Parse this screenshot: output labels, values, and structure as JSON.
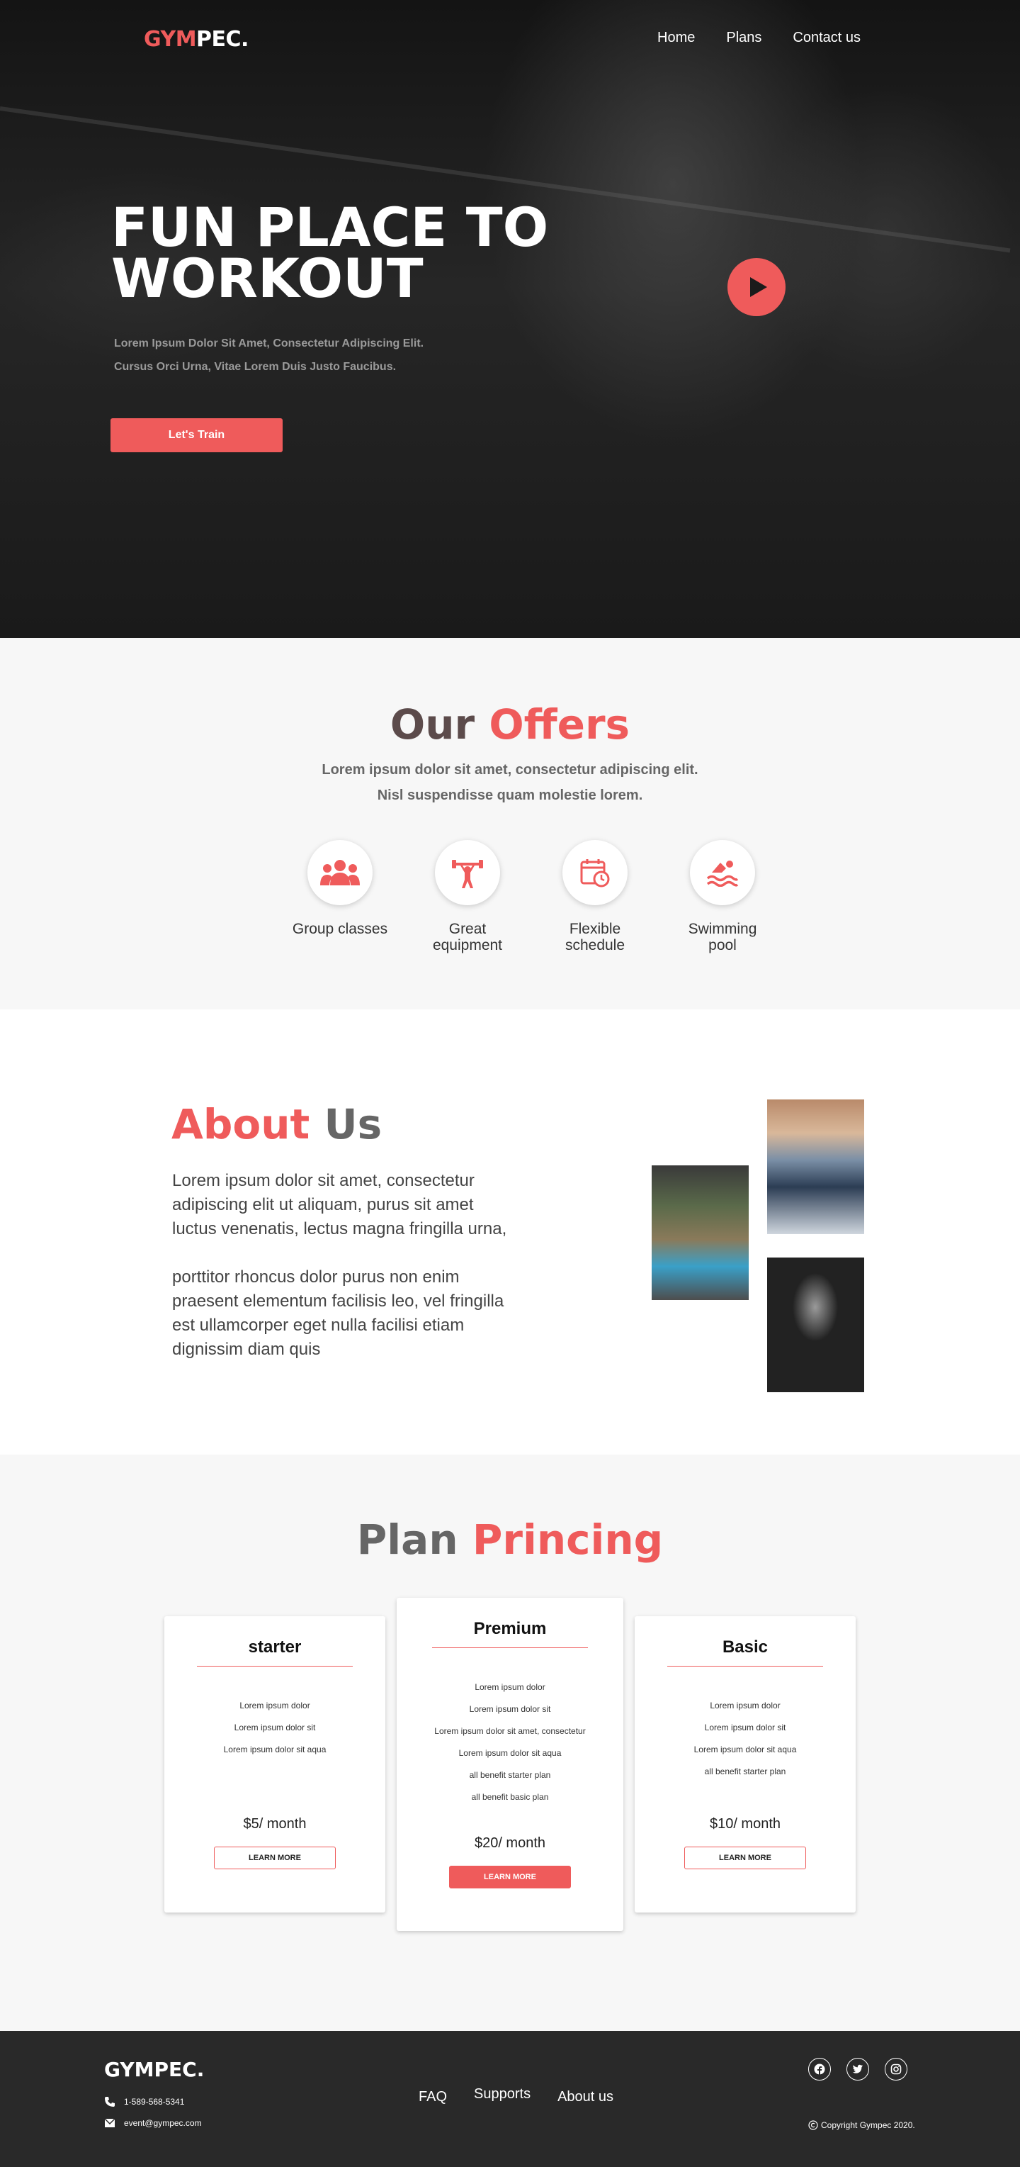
{
  "colors": {
    "accent": "#ef5b5b",
    "hero_bg": "#1b1b1b",
    "section_bg": "#f7f7f7",
    "footer_bg": "#292929"
  },
  "nav": {
    "logo_red": "GYM",
    "logo_white": "PEC.",
    "links": [
      "Home",
      "Plans",
      "Contact us"
    ]
  },
  "hero": {
    "title_line1": "FUN PLACE TO",
    "title_line2": "WORKOUT",
    "sub_line1": "Lorem Ipsum Dolor Sit Amet, Consectetur Adipiscing Elit.",
    "sub_line2": "Cursus Orci Urna, Vitae Lorem Duis Justo Faucibus.",
    "cta": "Let's Train",
    "play_icon": "play-icon"
  },
  "offers": {
    "title_a": "Our",
    "title_b": "Offers",
    "desc_line1": "Lorem ipsum dolor sit amet, consectetur adipiscing elit.",
    "desc_line2": "Nisl suspendisse quam molestie lorem.",
    "items": [
      {
        "icon": "group-icon",
        "label_l1": "Group classes",
        "label_l2": ""
      },
      {
        "icon": "weightlifter-icon",
        "label_l1": "Great",
        "label_l2": "equipment"
      },
      {
        "icon": "schedule-icon",
        "label_l1": "Flexible",
        "label_l2": "schedule"
      },
      {
        "icon": "swimming-icon",
        "label_l1": "Swimming",
        "label_l2": "pool"
      }
    ]
  },
  "about": {
    "title_a": "About",
    "title_b": "Us",
    "para1": "Lorem ipsum dolor sit amet, consectetur adipiscing elit ut aliquam, purus sit amet luctus venenatis, lectus magna fringilla urna,",
    "para2": "porttitor rhoncus dolor purus non enim praesent elementum facilisis leo, vel fringilla est ullamcorper eget nulla facilisi etiam dignissim diam quis"
  },
  "pricing": {
    "title_a": "Plan",
    "title_b": "Princing",
    "plans": [
      {
        "name": "starter",
        "features": [
          "Lorem ipsum dolor",
          "Lorem ipsum dolor sit",
          "Lorem ipsum dolor sit aqua"
        ],
        "price": "$5/ month",
        "button": "LEARN MORE"
      },
      {
        "name": "Premium",
        "features": [
          "Lorem ipsum dolor",
          "Lorem ipsum dolor sit",
          "Lorem ipsum dolor sit amet, consectetur",
          "Lorem ipsum dolor sit aqua",
          "all benefit starter plan",
          "all benefit basic plan"
        ],
        "price": "$20/ month",
        "button": "LEARN MORE"
      },
      {
        "name": "Basic",
        "features": [
          "Lorem ipsum dolor",
          "Lorem ipsum dolor sit",
          "Lorem ipsum dolor sit aqua",
          "all benefit starter plan"
        ],
        "price": "$10/ month",
        "button": "LEARN MORE"
      }
    ]
  },
  "footer": {
    "logo": "GYMPEC.",
    "phone": "1-589-568-5341",
    "email": "event@gympec.com",
    "links": [
      "FAQ",
      "Supports",
      "About us"
    ],
    "socials": [
      "facebook-icon",
      "twitter-icon",
      "instagram-icon"
    ],
    "copyright": "Copyright Gympec 2020."
  }
}
